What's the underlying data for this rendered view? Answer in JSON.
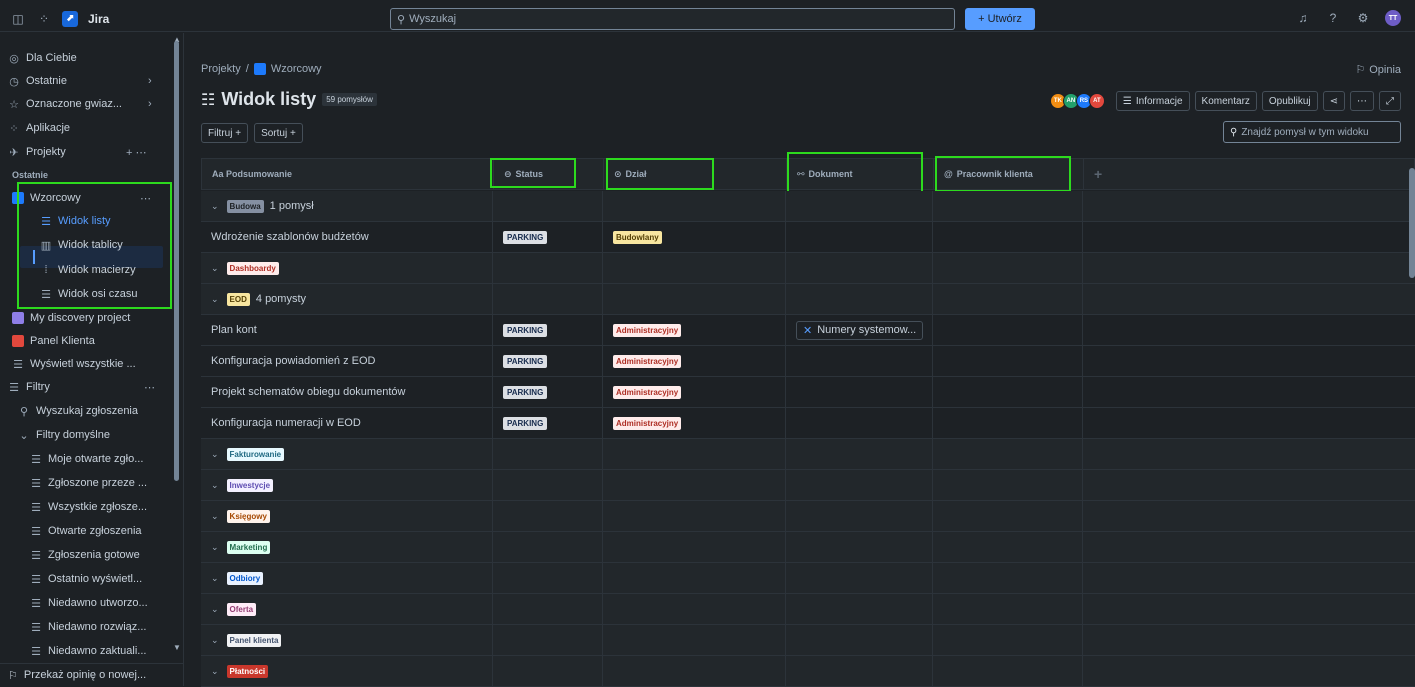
{
  "app": {
    "name": "Jira"
  },
  "topbar": {
    "search_placeholder": "Wyszukaj",
    "create_label": "Utwórz",
    "user_initials": "TT"
  },
  "sidebar": {
    "items": [
      {
        "label": "Dla Ciebie",
        "icon": "person-icon"
      },
      {
        "label": "Ostatnie",
        "icon": "clock-icon"
      },
      {
        "label": "Oznaczone gwiaz...",
        "icon": "star-icon"
      },
      {
        "label": "Aplikacje",
        "icon": "apps-icon"
      },
      {
        "label": "Projekty",
        "icon": "rocket-icon"
      }
    ],
    "recent_label": "Ostatnie",
    "project": {
      "name": "Wzorcowy",
      "views": [
        "Widok listy",
        "Widok tablicy",
        "Widok macierzy",
        "Widok osi czasu"
      ]
    },
    "other_projects": [
      "My discovery project",
      "Panel Klienta",
      "Wyświetl wszystkie ..."
    ],
    "filters_label": "Filtry",
    "filter_items": [
      "Wyszukaj zgłoszenia",
      "Filtry domyślne",
      "Moje otwarte zgło...",
      "Zgłoszone przeze ...",
      "Wszystkie zgłosze...",
      "Otwarte zgłoszenia",
      "Zgłoszenia gotowe",
      "Ostatnio wyświetl...",
      "Niedawno utworzo...",
      "Niedawno rozwiąz...",
      "Niedawno zaktuali..."
    ],
    "footer": "Przekaż opinię o nowej..."
  },
  "breadcrumb": {
    "root": "Projekty",
    "sep": "/",
    "project": "Wzorcowy"
  },
  "feedback": "Opinia",
  "header": {
    "title": "Widok listy",
    "count": "59 pomysłów"
  },
  "actions": {
    "avatars": [
      "TK",
      "AN",
      "RS",
      "AT"
    ],
    "info": "Informacje",
    "comment": "Komentarz",
    "publish": "Opublikuj",
    "more": "⋯",
    "expand": "⤢"
  },
  "filters": {
    "filter": "Filtruj +",
    "sort": "Sortuj +",
    "find_placeholder": "Znajdź pomysł w tym widoku"
  },
  "columns": {
    "summary": "Aa Podsumowanie",
    "status": "Status",
    "dept": "Dział",
    "doc": "Dokument",
    "client": "Pracownik klienta",
    "add": "+"
  },
  "rows": {
    "g_budowa": {
      "tag": "Budowa",
      "count": "1 pomysł"
    },
    "r1": {
      "summary": "Wdrożenie szablonów budżetów",
      "status": "PARKING",
      "dept": "Budowlany"
    },
    "g_dash": {
      "tag": "Dashboardy"
    },
    "g_eod": {
      "tag": "EOD",
      "count": "4 pomysty"
    },
    "r2": {
      "summary": "Plan kont",
      "status": "PARKING",
      "dept": "Administracyjny",
      "doc": "Numery systemow..."
    },
    "r3": {
      "summary": "Konfiguracja powiadomień z EOD",
      "status": "PARKING",
      "dept": "Administracyjny"
    },
    "r4": {
      "summary": "Projekt schematów obiegu dokumentów",
      "status": "PARKING",
      "dept": "Administracyjny"
    },
    "r5": {
      "summary": "Konfiguracja numeracji w EOD",
      "status": "PARKING",
      "dept": "Administracyjny"
    },
    "groups": [
      "Fakturowanie",
      "Inwestycje",
      "Księgowy",
      "Marketing",
      "Odbiory",
      "Oferta",
      "Panel klienta",
      "Płatności"
    ]
  },
  "colors": {
    "accent": "#579dff",
    "highlight": "#2dda1e"
  }
}
